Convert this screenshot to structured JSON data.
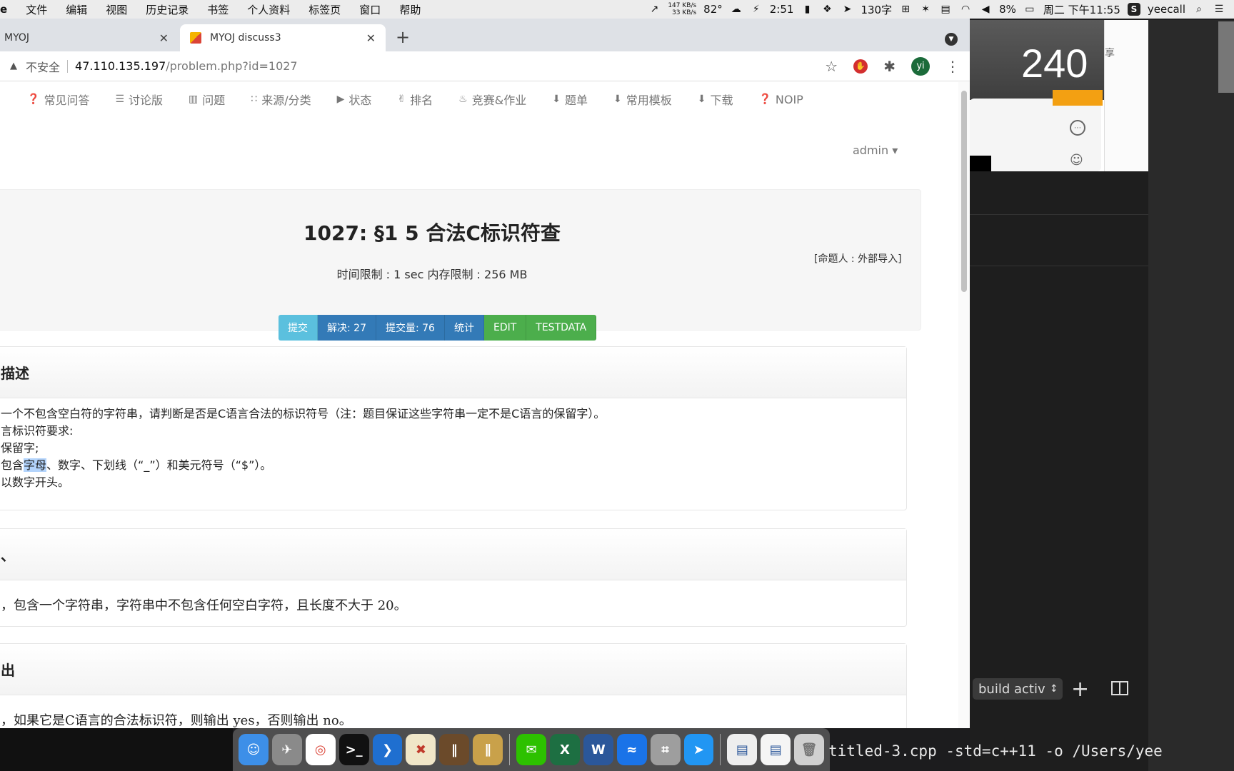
{
  "menubar": {
    "items": [
      "e",
      "文件",
      "编辑",
      "视图",
      "历史记录",
      "书签",
      "个人资料",
      "标签页",
      "窗口",
      "帮助"
    ],
    "net_up": "147 KB/s",
    "net_down": "33 KB/s",
    "temperature": "82°",
    "battery_time": "2:51",
    "word_count": "130字",
    "battery_percent": "8%",
    "datetime": "周二 下午11:55",
    "user": "yeecall"
  },
  "background": {
    "timer_value": "240",
    "share_label": "享",
    "build_select": "build activ",
    "terminal_command": "titled-3.cpp -std=c++11 -o /Users/yee"
  },
  "browser": {
    "tabs": [
      {
        "title": "MYOJ"
      },
      {
        "title": "MYOJ discuss3"
      }
    ],
    "insecure_label": "不安全",
    "url_host": "47.110.135.197",
    "url_path": "/problem.php?id=1027",
    "avatar_letter": "yi"
  },
  "nav": {
    "items": [
      "常见问答",
      "讨论版",
      "问题",
      "来源/分类",
      "状态",
      "排名",
      "竞赛&作业",
      "题单",
      "常用模板",
      "下载",
      "NOIP"
    ],
    "user": "admin"
  },
  "problem": {
    "title": "1027: §1 5 合法C标识符查",
    "author": "[命题人 : 外部导入]",
    "limits": "时间限制 : 1 sec  内存限制 : 256 MB",
    "buttons": [
      "提交",
      "解决: 27",
      "提交量: 76",
      "统计",
      "EDIT",
      "TESTDATA"
    ],
    "desc_heading": "描述",
    "desc_lines": [
      "一个不包含空白符的字符串，请判断是否是C语言合法的标识符号（注：题目保证这些字符串一定不是C语言的保留字）。",
      "言标识符要求:",
      "保留字;",
      "以数字开头。"
    ],
    "desc_line4_pre": "包含",
    "desc_line4_hl": "字母",
    "desc_line4_post": "、数字、下划线（“_”）和美元符号（“$”）。",
    "input_heading": "、",
    "input_line": "，包含一个字符串，字符串中不包含任何空白字符，且长度不大于 20。",
    "output_heading": "出",
    "output_line": "，如果它是C语言的合法标识符，则输出 yes，否则输出 no。"
  },
  "dock": {
    "excel_letter": "X",
    "word_letter": "W"
  },
  "colors": {
    "btn_info": "#5bc0de",
    "btn_primary": "#337ab7",
    "btn_success": "#4cae4c",
    "avatar": "#1b6b3a",
    "timer_accent": "#f3a012"
  }
}
